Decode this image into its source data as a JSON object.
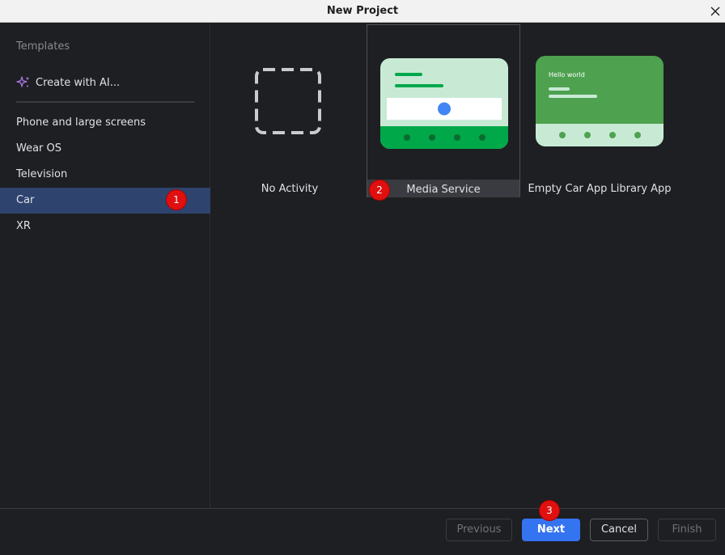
{
  "window": {
    "title": "New Project"
  },
  "sidebar": {
    "section_label": "Templates",
    "ai_item": {
      "label": "Create with AI..."
    },
    "items": [
      {
        "label": "Phone and large screens"
      },
      {
        "label": "Wear OS"
      },
      {
        "label": "Television"
      },
      {
        "label": "Car"
      },
      {
        "label": "XR"
      }
    ],
    "selected": "Car"
  },
  "templates": [
    {
      "label": "No Activity"
    },
    {
      "label": "Media Service",
      "selected": true
    },
    {
      "label": "Empty Car App Library App",
      "preview_text": "Hello world"
    }
  ],
  "badges": [
    "1",
    "2",
    "3"
  ],
  "footer": {
    "previous_label": "Previous",
    "next_label": "Next",
    "cancel_label": "Cancel",
    "finish_label": "Finish"
  },
  "colors": {
    "accent": "#3574f0",
    "selection": "#2e436e",
    "badge": "#e01010",
    "preview_green": "#00a84a",
    "preview_light_green": "#c8ead5"
  }
}
